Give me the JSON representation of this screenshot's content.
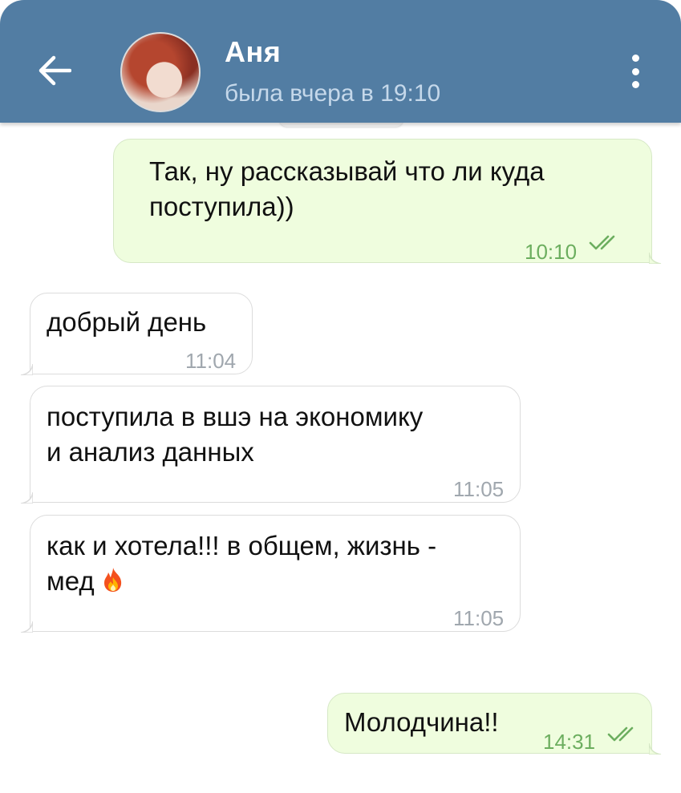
{
  "header": {
    "contact_name": "Аня",
    "contact_status": "была вчера в 19:10",
    "icons": {
      "back": "arrow-left-icon",
      "avatar": "avatar",
      "menu": "more-vertical-icon"
    }
  },
  "colors": {
    "header_bg": "#527da3",
    "outgoing_bubble": "#effdde",
    "incoming_bubble": "#ffffff",
    "outgoing_time": "#6cae5f",
    "incoming_time": "#a0a7ae"
  },
  "messages": [
    {
      "direction": "out",
      "line1": "Так, ну рассказывай что ли куда",
      "line2": "поступила))",
      "time": "10:10",
      "status": "read"
    },
    {
      "direction": "in",
      "line1": "добрый день",
      "time": "11:04"
    },
    {
      "direction": "in",
      "line1": "поступила в вшэ на экономику",
      "line2": "и анализ данных",
      "time": "11:05"
    },
    {
      "direction": "in",
      "line1": "как и хотела!!! в общем, жизнь -",
      "line2": "мед",
      "emoji": "fire-emoji",
      "time": "11:05"
    },
    {
      "direction": "out",
      "line1": "Молодчина!!",
      "time": "14:31",
      "status": "read"
    }
  ]
}
